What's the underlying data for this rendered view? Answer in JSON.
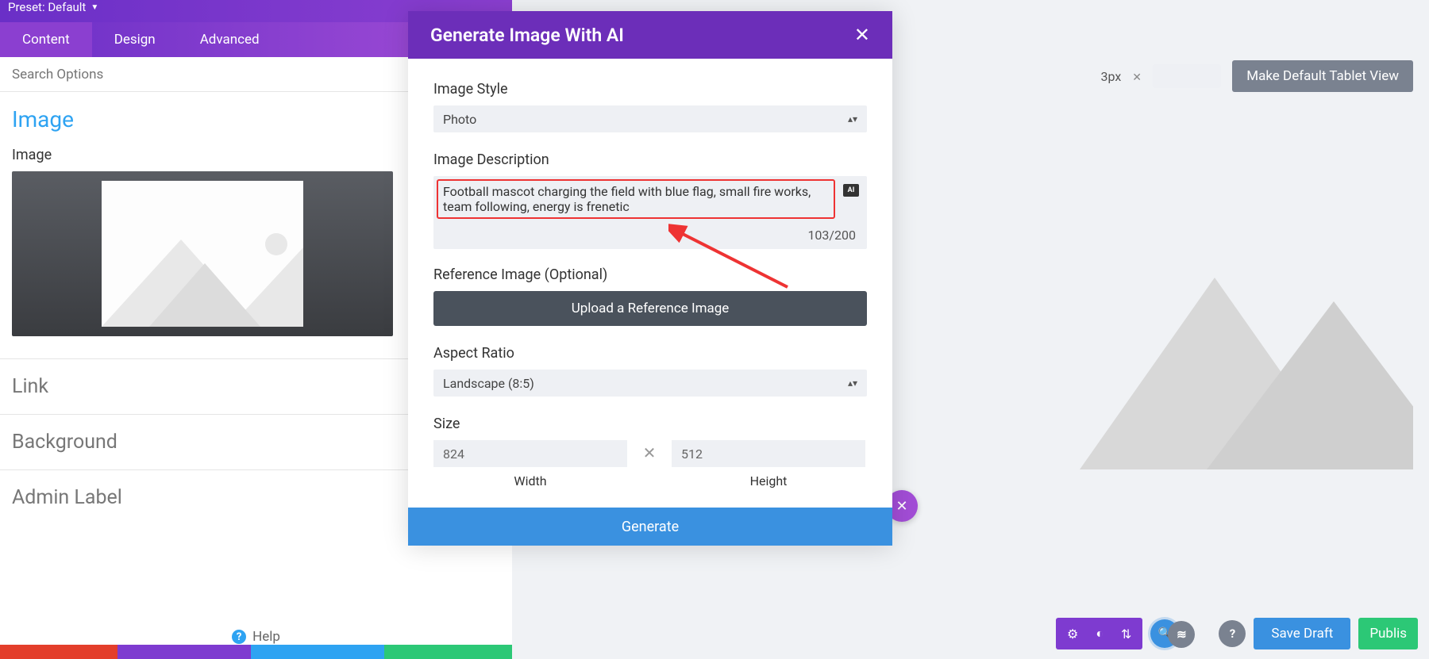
{
  "preset": {
    "label": "Preset: Default"
  },
  "tabs": {
    "content": "Content",
    "design": "Design",
    "advanced": "Advanced"
  },
  "search": {
    "placeholder": "Search Options"
  },
  "left_panel": {
    "section_title": "Image",
    "field_label": "Image",
    "accordion": [
      "Link",
      "Background",
      "Admin Label"
    ],
    "help": "Help"
  },
  "modal": {
    "title": "Generate Image With AI",
    "labels": {
      "style": "Image Style",
      "desc": "Image Description",
      "ref": "Reference Image (Optional)",
      "aspect": "Aspect Ratio",
      "size": "Size",
      "width": "Width",
      "height": "Height"
    },
    "style_value": "Photo",
    "desc_value": "Football mascot charging the field with blue flag, small fire works, team following, energy is frenetic",
    "char_count": "103/200",
    "ai_badge": "AI",
    "upload_label": "Upload a Reference Image",
    "aspect_value": "Landscape (8:5)",
    "width_value": "824",
    "height_value": "512",
    "generate_label": "Generate"
  },
  "top_controls": {
    "dim_suffix": "3px",
    "default_view_btn": "Make Default Tablet View"
  },
  "bottom_bar": {
    "save_draft": "Save Draft",
    "publish": "Publis"
  }
}
